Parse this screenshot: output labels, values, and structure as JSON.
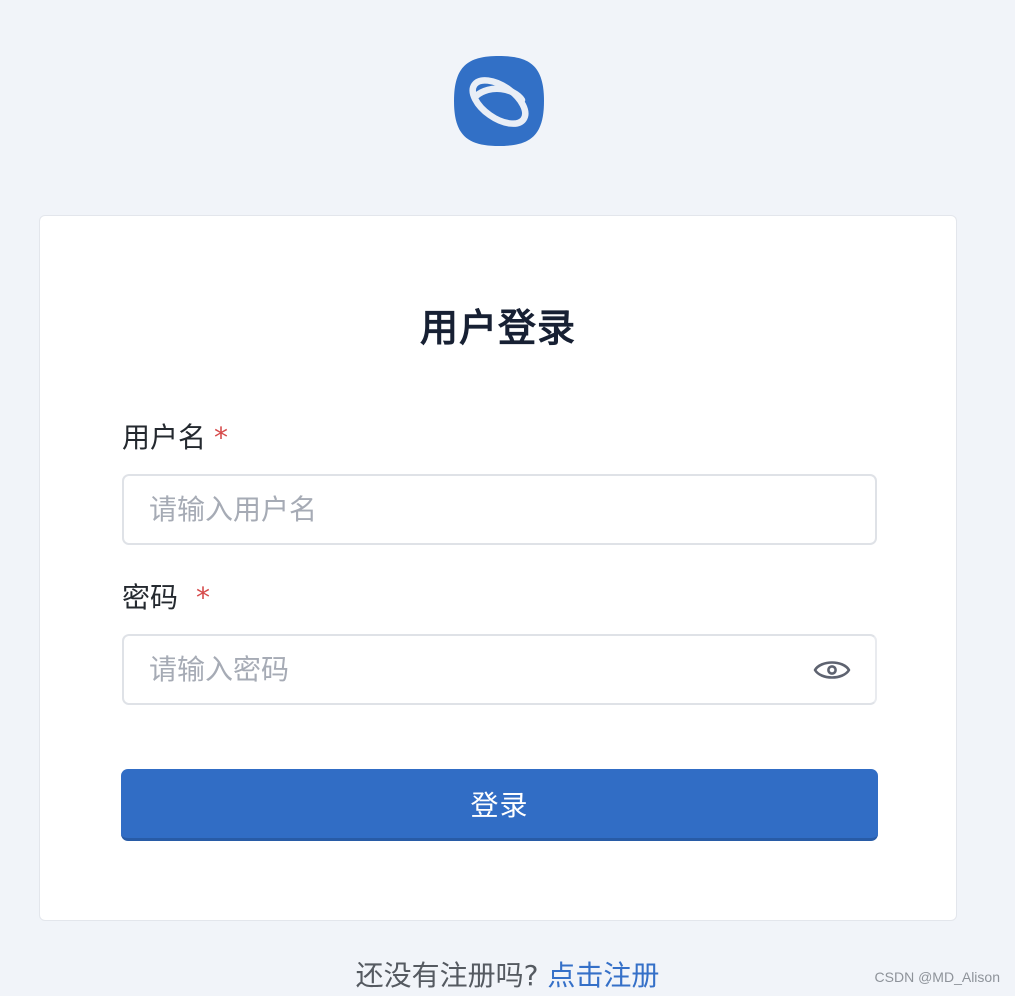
{
  "logo": {
    "icon": "app-logo-icon",
    "color": "#3270c6"
  },
  "card": {
    "title": "用户登录",
    "username": {
      "label": "用户名",
      "required_mark": "*",
      "placeholder": "请输入用户名",
      "value": ""
    },
    "password": {
      "label": "密码",
      "required_mark": "*",
      "placeholder": "请输入密码",
      "value": "",
      "toggle_icon": "eye-icon"
    },
    "login_label": "登录"
  },
  "footer": {
    "prompt": "还没有注册吗?",
    "register_link": "点击注册"
  },
  "watermark": "CSDN @MD_Alison",
  "colors": {
    "background": "#f1f4f9",
    "primary": "#316dc5",
    "required": "#d64a4a",
    "link": "#3570c8"
  }
}
